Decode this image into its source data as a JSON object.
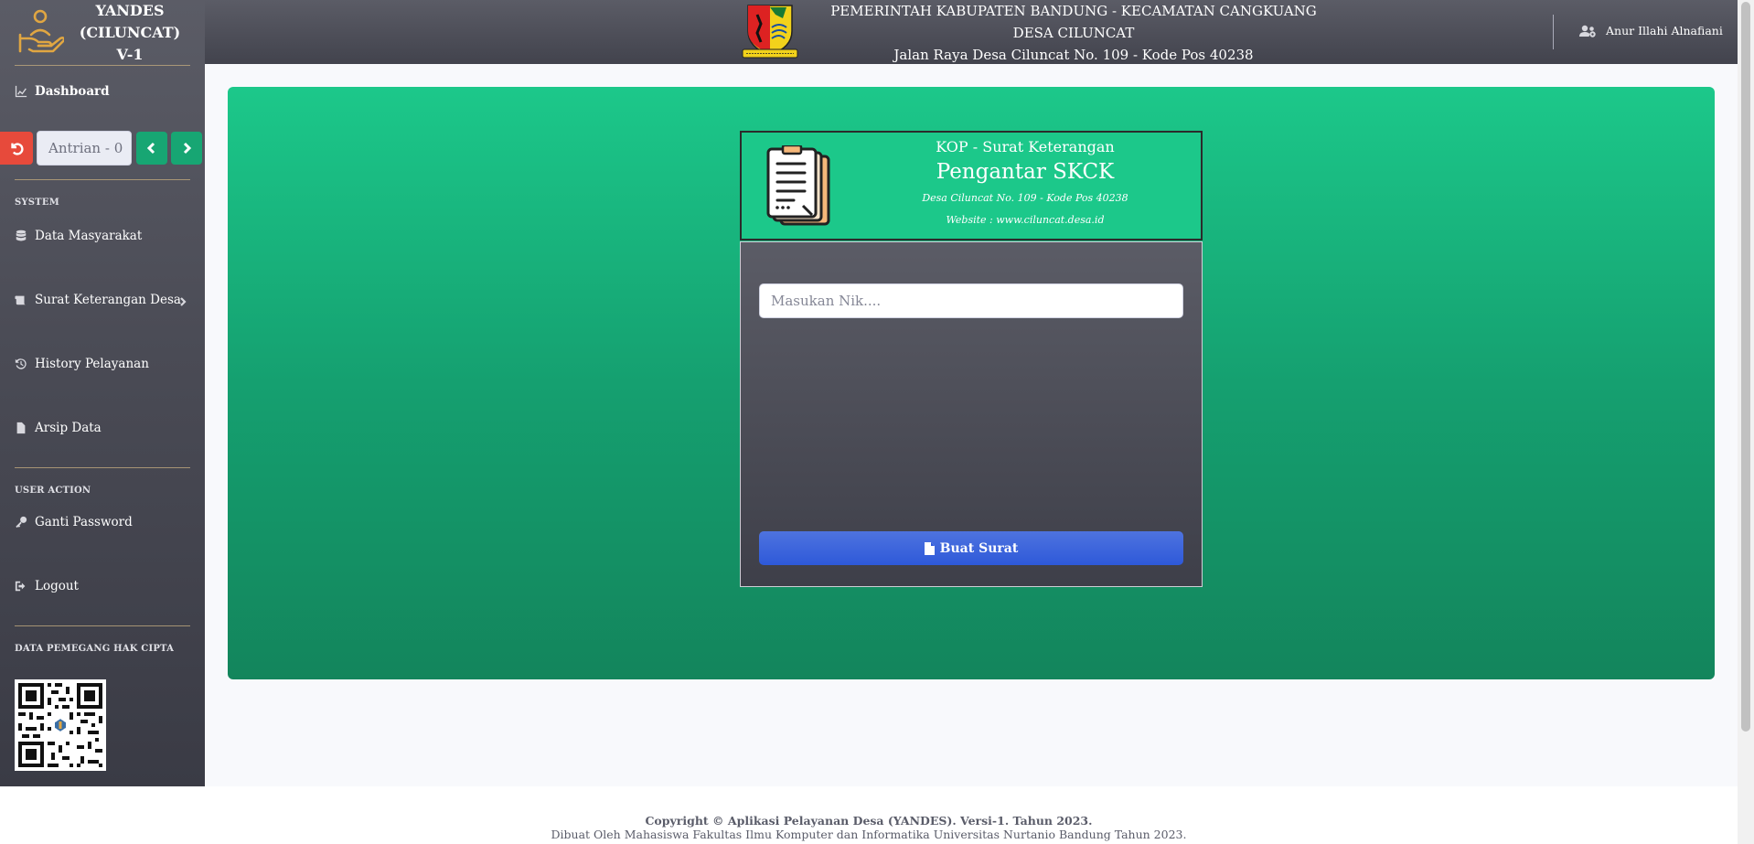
{
  "brand": {
    "line1": "YANDES",
    "line2": "(CILUNCAT)",
    "line3": "V-1"
  },
  "sidebar": {
    "dashboard": "Dashboard",
    "queue": {
      "value": "Antrian - 0"
    },
    "section_system": "SYSTEM",
    "items": [
      {
        "label": "Data Masyarakat",
        "icon": "database-icon"
      },
      {
        "label": "Surat Keterangan Desa",
        "icon": "scroll-icon"
      },
      {
        "label": "History Pelayanan",
        "icon": "history-icon"
      },
      {
        "label": "Arsip Data",
        "icon": "file-icon"
      }
    ],
    "section_user": "USER ACTION",
    "user_items": [
      {
        "label": "Ganti Password",
        "icon": "key-icon"
      },
      {
        "label": "Logout",
        "icon": "sign-out-icon"
      }
    ],
    "section_copyright": "DATA PEMEGANG HAK CIPTA"
  },
  "topbar": {
    "line1": "PEMERINTAH KABUPATEN BANDUNG - KECAMATAN CANGKUANG",
    "line2": "DESA CILUNCAT",
    "line3": "Jalan Raya Desa Ciluncat No. 109 - Kode Pos 40238",
    "user_name": "Anur Illahi Alnafiani"
  },
  "kop": {
    "subtitle": "KOP - Surat Keterangan",
    "title": "Pengantar SKCK",
    "address": "Desa Ciluncat No. 109 - Kode Pos 40238",
    "website": "Website : www.ciluncat.desa.id"
  },
  "form": {
    "nik_placeholder": "Masukan Nik....",
    "submit_label": "Buat Surat"
  },
  "footer": {
    "line1": "Copyright © Aplikasi Pelayanan Desa (YANDES). Versi-1. Tahun 2023.",
    "line2": "Dibuat Oleh Mahasiswa Fakultas Ilmu Komputer dan Informatika Universitas Nurtanio Bandung Tahun 2023."
  },
  "colors": {
    "success": "#1cc88a",
    "primary": "#4e73df",
    "danger": "#e74a3b",
    "sidebar": "#4a4b55"
  }
}
